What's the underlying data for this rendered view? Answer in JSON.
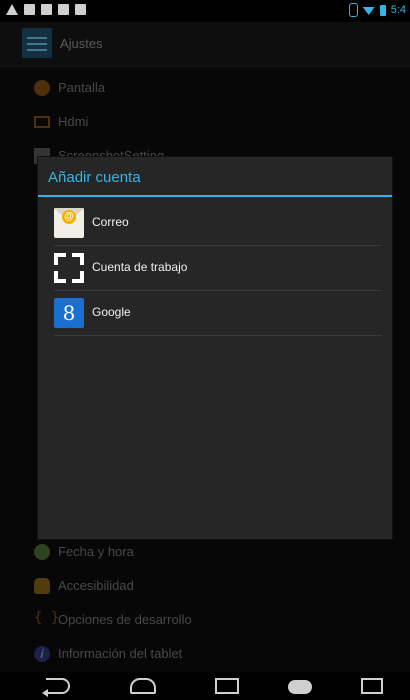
{
  "status_bar": {
    "left_icons": [
      "warning-icon",
      "image-icon",
      "mail-icon",
      "app-icon",
      "screenshot-icon"
    ],
    "time": "5:4"
  },
  "background": {
    "title": "Ajustes",
    "top_items": [
      {
        "icon": "brightness-icon",
        "label": "Pantalla"
      },
      {
        "icon": "monitor-icon",
        "label": "Hdmi"
      },
      {
        "icon": "screenshot-icon",
        "label": "ScreenshotSetting"
      }
    ],
    "bottom_items": [
      {
        "icon": "clock-icon",
        "label": "Fecha y hora"
      },
      {
        "icon": "hand-icon",
        "label": "Accesibilidad"
      },
      {
        "icon": "braces-icon",
        "label": "Opciones de desarrollo"
      },
      {
        "icon": "info-icon",
        "label": "Información del tablet"
      }
    ]
  },
  "dialog": {
    "title": "Añadir cuenta",
    "accounts": [
      {
        "icon": "mail-icon",
        "label": "Correo"
      },
      {
        "icon": "work-account-icon",
        "label": "Cuenta de trabajo"
      },
      {
        "icon": "google-icon",
        "label": "Google"
      }
    ]
  },
  "colors": {
    "accent": "#33b5e5",
    "dialog_bg": "#262626"
  },
  "nav_bar": [
    "back-icon",
    "home-icon",
    "recent-apps-icon",
    "gamepad-icon",
    "screenshot-icon"
  ]
}
